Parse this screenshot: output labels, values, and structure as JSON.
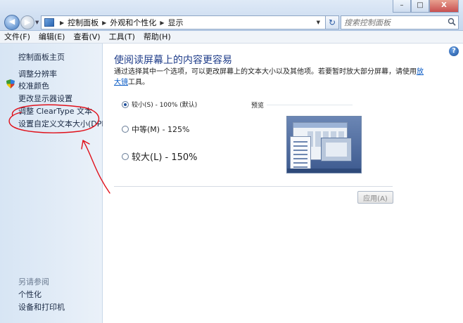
{
  "window": {
    "minimize": "–",
    "maximize": "□",
    "close": "X"
  },
  "navigation": {
    "back": "◀",
    "forward": "▶",
    "refresh": "↻"
  },
  "breadcrumb": [
    "控制面板",
    "外观和个性化",
    "显示"
  ],
  "search": {
    "placeholder": "搜索控制面板"
  },
  "menu": [
    "文件(F)",
    "编辑(E)",
    "查看(V)",
    "工具(T)",
    "帮助(H)"
  ],
  "sidebar": {
    "links": [
      "控制面板主页",
      "调整分辨率",
      "校准颜色",
      "更改显示器设置",
      "调整 ClearType 文本",
      "设置自定义文本大小(DPI)"
    ],
    "see_also_heading": "另请参阅",
    "see_also": [
      "个性化",
      "设备和打印机"
    ]
  },
  "main": {
    "help": "?",
    "title": "使阅读屏幕上的内容更容易",
    "description_before": "通过选择其中一个选项，可以更改屏幕上的文本大小以及其他项。若要暂时放大部分屏幕，请使用",
    "magnifier_link": "放大镜",
    "description_after": "工具。",
    "options": [
      {
        "label": "较小(S) - 100% (默认)",
        "checked": true
      },
      {
        "label": "中等(M) - 125%",
        "checked": false
      },
      {
        "label": "较大(L) - 150%",
        "checked": false
      }
    ],
    "preview_label": "预览",
    "apply_button": "应用(A)"
  },
  "colors": {
    "accent_link": "#0b5cc6",
    "title_blue": "#1f3d8a",
    "annotation_red": "#e0101a"
  }
}
